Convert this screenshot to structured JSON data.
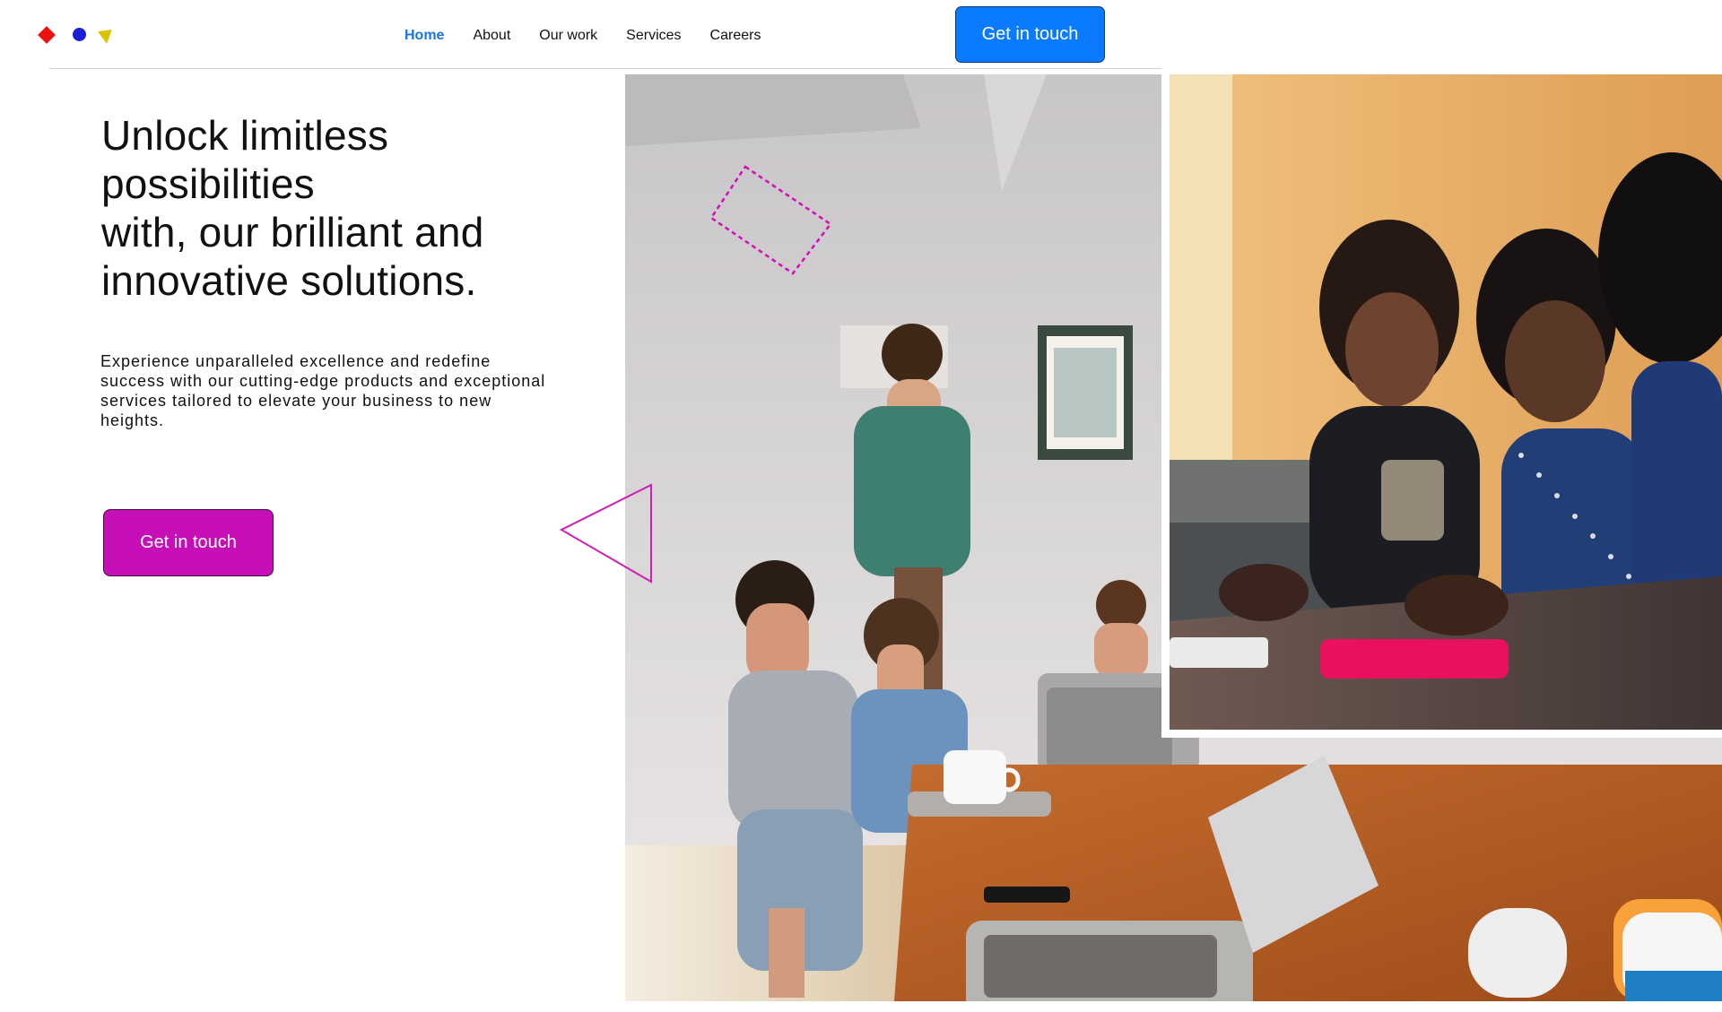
{
  "brand": {
    "logo_icons": [
      "red-diamond-icon",
      "blue-circle-icon",
      "yellow-triangle-icon"
    ],
    "colors": {
      "red": "#ee1111",
      "blue": "#1a20d6",
      "yellow": "#d8c400",
      "primary": "#0a7bff",
      "magenta": "#c70fb7",
      "nav_active": "#1876e8"
    }
  },
  "nav": {
    "items": [
      {
        "label": "Home",
        "active": true
      },
      {
        "label": "About",
        "active": false
      },
      {
        "label": "Our work",
        "active": false
      },
      {
        "label": "Services",
        "active": false
      },
      {
        "label": "Careers",
        "active": false
      }
    ],
    "cta_label": "Get in touch"
  },
  "hero": {
    "title_lines": [
      "Unlock limitless",
      "possibilities",
      "with, our brilliant and",
      "innovative solutions."
    ],
    "body": "Experience unparalleled excellence and redefine success with our cutting-edge products and exceptional services tailored to elevate your business to new heights.",
    "cta_label": "Get in touch"
  },
  "decorations": {
    "shapes": [
      "outline-triangle-icon",
      "dashed-square-icon"
    ]
  }
}
